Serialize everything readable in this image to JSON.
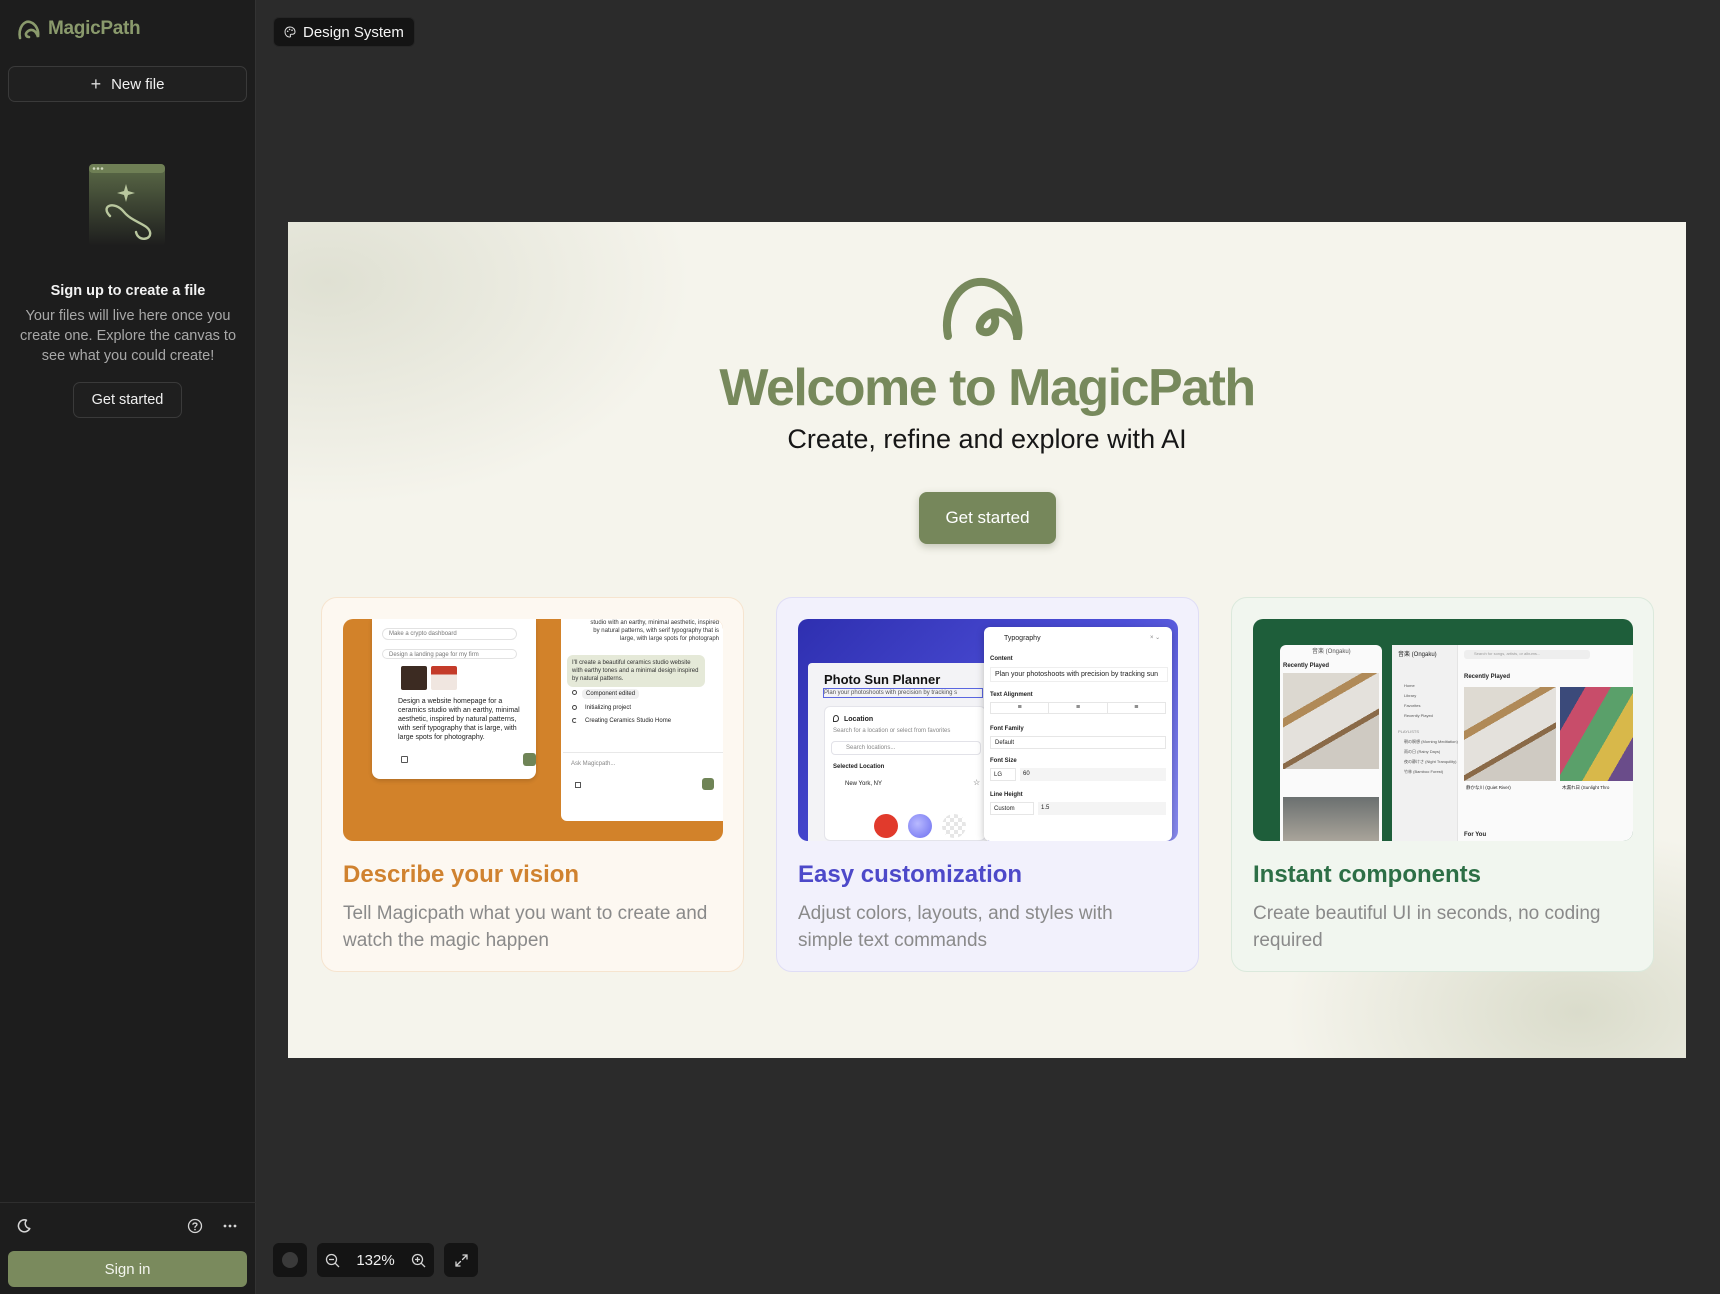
{
  "sidebar": {
    "app_name": "MagicPath",
    "new_file_label": "New file",
    "empty_title": "Sign up to create a file",
    "empty_description": "Your files will live here once you create one. Explore the canvas to see what you could create!",
    "get_started_label": "Get started",
    "sign_in_label": "Sign in",
    "bottom_icons": [
      "moon-icon",
      "help-icon",
      "more-icon"
    ]
  },
  "top_tag": {
    "label": "Design System",
    "icon": "palette-icon"
  },
  "canvas": {
    "title": "Welcome to MagicPath",
    "subtitle": "Create, refine and explore with AI",
    "cta_label": "Get started",
    "cards": [
      {
        "title": "Describe your vision",
        "description": "Tell Magicpath what you want to create and watch the magic happen",
        "accent": "#d0822f",
        "mock": {
          "chip1": "Make a crypto dashboard",
          "chip2": "Design a landing page for my firm",
          "prompt": "Design a website homepage for a ceramics studio with an earthy, minimal aesthetic, inspired by natural patterns, with serif typography that is large, with large spots for photography.",
          "top_text": "studio with an earthy, minimal aesthetic, inspired by natural patterns, with serif typography that is large, with large spots for photograph",
          "reply": "I'll create a beautiful ceramics studio website with earthy tones and a minimal design inspired by natural patterns.",
          "step1": "Component edited",
          "step2": "Initializing project",
          "step3": "Creating Ceramics Studio Home",
          "ask_placeholder": "Ask Magicpath..."
        }
      },
      {
        "title": "Easy customization",
        "description": "Adjust colors, layouts, and styles with simple text commands",
        "accent": "#4d49c9",
        "mock": {
          "app_title": "Photo Sun Planner",
          "app_subtitle": "Plan your photoshoots with precision by tracking s",
          "location_label": "Location",
          "location_hint": "Search for a location or select from favorites",
          "search_placeholder": "Search locations...",
          "selected_label": "Selected Location",
          "selected_value": "New York, NY",
          "panel_title": "Typography",
          "content_label": "Content",
          "content_value": "Plan your photoshoots with precision by tracking sun",
          "align_label": "Text Alignment",
          "font_family_label": "Font Family",
          "font_family_value": "Default",
          "font_size_label": "Font Size",
          "font_size_unit": "LG",
          "font_size_value": "60",
          "line_height_label": "Line Height",
          "line_height_mode": "Custom",
          "line_height_value": "1.5"
        }
      },
      {
        "title": "Instant components",
        "description": "Create beautiful UI in seconds, no coding required",
        "accent": "#2d6f46",
        "mock": {
          "header_small": "音楽 (Ongaku)",
          "recently_played": "Recently Played",
          "search_placeholder": "Search for songs, artists, or albums...",
          "nav": [
            "Home",
            "Library",
            "Favorites",
            "Recently Played"
          ],
          "playlists_label": "PLAYLISTS",
          "playlists": [
            "朝の瞑想 (Morning Meditation)",
            "雨の日 (Rainy Days)",
            "夜の静けさ (Night Tranquility)",
            "竹林 (Bamboo Forest)"
          ],
          "track1": "静かな川 (Quiet River)",
          "track2": "木漏れ日 (Sunlight Thro",
          "for_you": "For You"
        }
      }
    ]
  },
  "bottom_bar": {
    "zoom_level": "132%"
  },
  "colors": {
    "brand": "#77895c",
    "sidebar_bg": "#1d1d1d",
    "canvas_bg": "#2b2b2b"
  }
}
